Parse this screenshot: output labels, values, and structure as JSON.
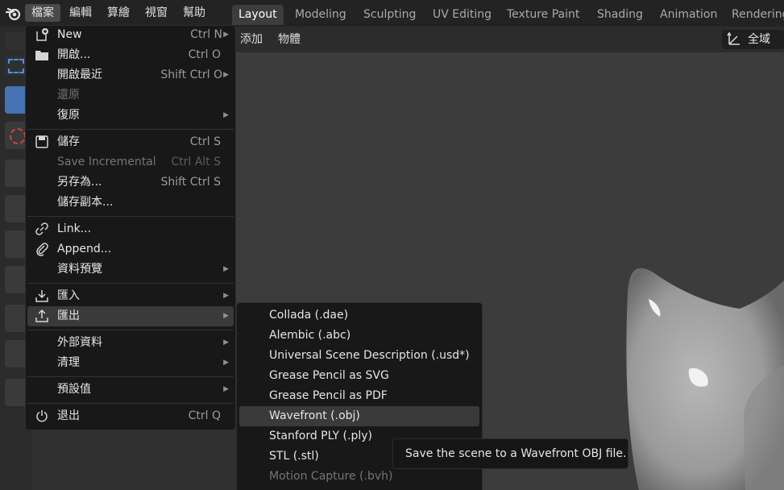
{
  "top_menu": [
    {
      "label": "檔案",
      "active": true
    },
    {
      "label": "編輯"
    },
    {
      "label": "算繪"
    },
    {
      "label": "視窗"
    },
    {
      "label": "幫助"
    }
  ],
  "workspace_tabs": [
    {
      "label": "Layout",
      "active": true
    },
    {
      "label": "Modeling"
    },
    {
      "label": "Sculpting"
    },
    {
      "label": "UV Editing"
    },
    {
      "label": "Texture Paint"
    },
    {
      "label": "Shading"
    },
    {
      "label": "Animation"
    },
    {
      "label": "Rendering"
    }
  ],
  "viewport_header": {
    "add_label": "添加",
    "object_label": "物體",
    "orientation_label": "全域"
  },
  "file_menu": {
    "items": [
      {
        "id": "new",
        "icon": "new-file-icon",
        "label": "New",
        "shortcut": "Ctrl N",
        "arrow": true
      },
      {
        "id": "open",
        "icon": "folder-icon",
        "label": "開啟...",
        "shortcut": "Ctrl O"
      },
      {
        "id": "open-recent",
        "label": "開啟最近",
        "shortcut": "Shift Ctrl O",
        "arrow": true
      },
      {
        "id": "revert",
        "label": "還原",
        "disabled": true
      },
      {
        "id": "recover",
        "label": "復原",
        "arrow": true
      },
      {
        "id": "save",
        "icon": "save-icon",
        "label": "儲存",
        "shortcut": "Ctrl S"
      },
      {
        "id": "save-incremental",
        "label": "Save Incremental",
        "shortcut": "Ctrl Alt S",
        "disabled": true
      },
      {
        "id": "save-as",
        "label": "另存為...",
        "shortcut": "Shift Ctrl S"
      },
      {
        "id": "save-copy",
        "label": "儲存副本..."
      },
      {
        "id": "link",
        "icon": "link-icon",
        "label": "Link..."
      },
      {
        "id": "append",
        "icon": "append-icon",
        "label": "Append..."
      },
      {
        "id": "data-previews",
        "label": "資料預覽",
        "arrow": true
      },
      {
        "id": "import",
        "icon": "import-icon",
        "label": "匯入",
        "arrow": true
      },
      {
        "id": "export",
        "icon": "export-icon",
        "label": "匯出",
        "arrow": true,
        "highlighted": true
      },
      {
        "id": "external-data",
        "label": "外部資料",
        "arrow": true
      },
      {
        "id": "clean-up",
        "label": "清理",
        "arrow": true
      },
      {
        "id": "defaults",
        "label": "預設值",
        "arrow": true
      },
      {
        "id": "quit",
        "icon": "power-icon",
        "label": "退出",
        "shortcut": "Ctrl Q"
      }
    ]
  },
  "export_menu": {
    "items": [
      {
        "id": "collada",
        "label": "Collada (.dae)"
      },
      {
        "id": "alembic",
        "label": "Alembic (.abc)"
      },
      {
        "id": "usd",
        "label": "Universal Scene Description (.usd*)"
      },
      {
        "id": "gp-svg",
        "label": "Grease Pencil as SVG"
      },
      {
        "id": "gp-pdf",
        "label": "Grease Pencil as PDF"
      },
      {
        "id": "obj",
        "label": "Wavefront (.obj)",
        "highlighted": true
      },
      {
        "id": "ply",
        "label": "Stanford PLY (.ply)"
      },
      {
        "id": "stl",
        "label": "STL (.stl)"
      },
      {
        "id": "bvh",
        "label": "Motion Capture (.bvh)",
        "disabled": true
      }
    ]
  },
  "tooltip": {
    "text": "Save the scene to a Wavefront OBJ file."
  },
  "colors": {
    "accent": "#4772b3",
    "menu_bg": "#181818",
    "highlight": "#3a3a3a"
  }
}
